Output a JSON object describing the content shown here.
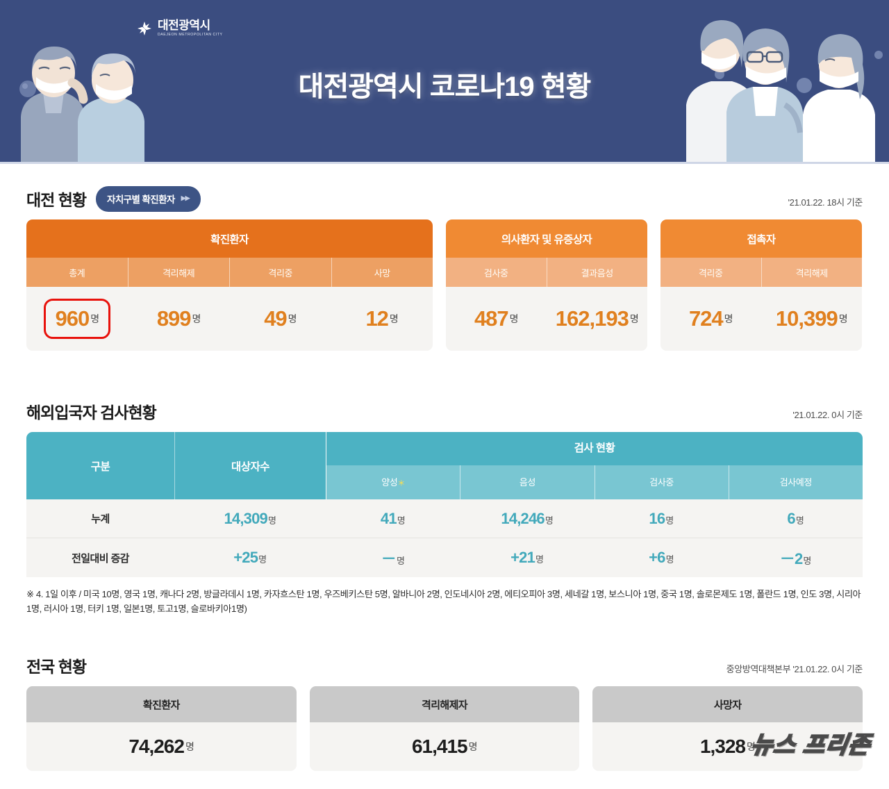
{
  "header": {
    "logo_kr": "대전광역시",
    "logo_en": "DAEJEON METROPOLITAN CITY",
    "title": "대전광역시 코로나19 현황",
    "bg_color": "#3b4d80"
  },
  "daejeon": {
    "section_title": "대전 현황",
    "button_label": "자치구별 확진환자",
    "button_arrows": "▶▶",
    "note": "'21.01.22. 18시 기준",
    "cards": [
      {
        "title": "확진환자",
        "columns": [
          "총계",
          "격리해제",
          "격리중",
          "사망"
        ],
        "values": [
          "960",
          "899",
          "49",
          "12"
        ],
        "units": [
          "명",
          "명",
          "명",
          "명"
        ],
        "highlight_index": 0
      },
      {
        "title": "의사환자 및 유증상자",
        "columns": [
          "검사중",
          "결과음성"
        ],
        "values": [
          "487",
          "162,193"
        ],
        "units": [
          "명",
          "명"
        ],
        "highlight_index": -1
      },
      {
        "title": "접촉자",
        "columns": [
          "격리중",
          "격리해제"
        ],
        "values": [
          "724",
          "10,399"
        ],
        "units": [
          "명",
          "명"
        ],
        "highlight_index": -1
      }
    ],
    "colors": {
      "header": "#e5711c",
      "subheader": "#eda063",
      "value": "#e0801f"
    }
  },
  "overseas": {
    "section_title": "해외입국자 검사현황",
    "note": "'21.01.22. 0시 기준",
    "col_division": "구분",
    "col_target": "대상자수",
    "group_header": "검사 현황",
    "sub_columns": [
      "양성",
      "음성",
      "검사중",
      "검사예정"
    ],
    "asterisk": "＊",
    "rows": [
      {
        "label": "누계",
        "target": "14,309",
        "values": [
          "41",
          "14,246",
          "16",
          "6"
        ],
        "unit": "명"
      },
      {
        "label": "전일대비 증감",
        "target": "+25",
        "values": [
          "－",
          "+21",
          "+6",
          "－2"
        ],
        "unit": "명"
      }
    ],
    "footnote": "※ 4. 1일 이후 / 미국 10명, 영국 1명, 캐나다 2명, 방글라데시 1명, 카자흐스탄 1명, 우즈베키스탄 5명, 알바니아 2명, 인도네시아 2명, 에티오피아 3명, 세네갈 1명, 보스니아 1명, 중국 1명, 솔로몬제도 1명, 폴란드 1명, 인도 3명, 시리아 1명, 러시아 1명, 터키 1명, 일본1명, 토고1명, 슬로바키아1명)",
    "colors": {
      "header": "#4cb2c3",
      "subheader": "#79c6d2",
      "value": "#42a9bb"
    }
  },
  "national": {
    "section_title": "전국 현황",
    "note": "중앙방역대책본부 '21.01.22. 0시 기준",
    "cards": [
      {
        "title": "확진환자",
        "value": "74,262",
        "unit": "명"
      },
      {
        "title": "격리해제자",
        "value": "61,415",
        "unit": "명"
      },
      {
        "title": "사망자",
        "value": "1,328",
        "unit": "명"
      }
    ],
    "colors": {
      "header": "#c9c9c9",
      "value": "#1e1e1e"
    }
  },
  "watermark": {
    "text": "뉴스 프리존"
  }
}
